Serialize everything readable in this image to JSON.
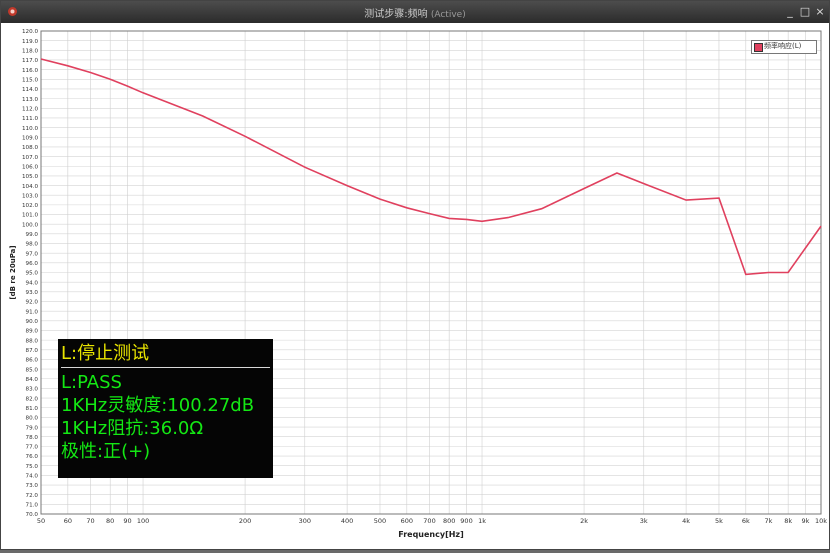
{
  "window": {
    "title": "测试步骤:频响",
    "title_sub": "(Active)",
    "controls": {
      "minimize": "_",
      "maximize": "□",
      "close": "×"
    }
  },
  "colors": {
    "curve": "#e0405e",
    "status_text": "#e8e400",
    "result_text": "#14e814",
    "panel_bg": "#050505"
  },
  "legend": {
    "label": "频率响应(L)"
  },
  "info_panel": {
    "status": "L:停止测试",
    "result": "L:PASS",
    "sensitivity": "1KHz灵敏度:100.27dB",
    "impedance": "1KHz阻抗:36.0Ω",
    "polarity": "极性:正(+)"
  },
  "chart_data": {
    "type": "line",
    "xlabel": "Frequency[Hz]",
    "ylabel": "[dB re 20uPa]",
    "x_scale": "log",
    "xlim": [
      50,
      10000
    ],
    "ylim": [
      70,
      120
    ],
    "y_tick_step": 1,
    "grid": true,
    "legend_position": "top-right",
    "x_ticks": [
      {
        "value": 50,
        "label": "50"
      },
      {
        "value": 60,
        "label": "60"
      },
      {
        "value": 70,
        "label": "70"
      },
      {
        "value": 80,
        "label": "80"
      },
      {
        "value": 90,
        "label": "90"
      },
      {
        "value": 100,
        "label": "100"
      },
      {
        "value": 200,
        "label": "200"
      },
      {
        "value": 300,
        "label": "300"
      },
      {
        "value": 400,
        "label": "400"
      },
      {
        "value": 500,
        "label": "500"
      },
      {
        "value": 600,
        "label": "600"
      },
      {
        "value": 700,
        "label": "700"
      },
      {
        "value": 800,
        "label": "800"
      },
      {
        "value": 900,
        "label": "900"
      },
      {
        "value": 1000,
        "label": "1k"
      },
      {
        "value": 2000,
        "label": "2k"
      },
      {
        "value": 3000,
        "label": "3k"
      },
      {
        "value": 4000,
        "label": "4k"
      },
      {
        "value": 5000,
        "label": "5k"
      },
      {
        "value": 6000,
        "label": "6k"
      },
      {
        "value": 7000,
        "label": "7k"
      },
      {
        "value": 8000,
        "label": "8k"
      },
      {
        "value": 9000,
        "label": "9k"
      },
      {
        "value": 10000,
        "label": "10k"
      }
    ],
    "series": [
      {
        "name": "频率响应(L)",
        "x": [
          50,
          60,
          70,
          80,
          90,
          100,
          150,
          200,
          300,
          400,
          500,
          600,
          700,
          800,
          900,
          1000,
          1200,
          1500,
          2000,
          2500,
          3000,
          4000,
          5000,
          6000,
          7000,
          8000,
          10000
        ],
        "y": [
          117.1,
          116.4,
          115.7,
          115.0,
          114.3,
          113.6,
          111.2,
          109.1,
          105.9,
          104.0,
          102.6,
          101.7,
          101.1,
          100.6,
          100.5,
          100.3,
          100.7,
          101.6,
          103.7,
          105.3,
          104.2,
          102.5,
          102.7,
          94.8,
          95.0,
          95.0,
          99.8
        ]
      }
    ]
  }
}
